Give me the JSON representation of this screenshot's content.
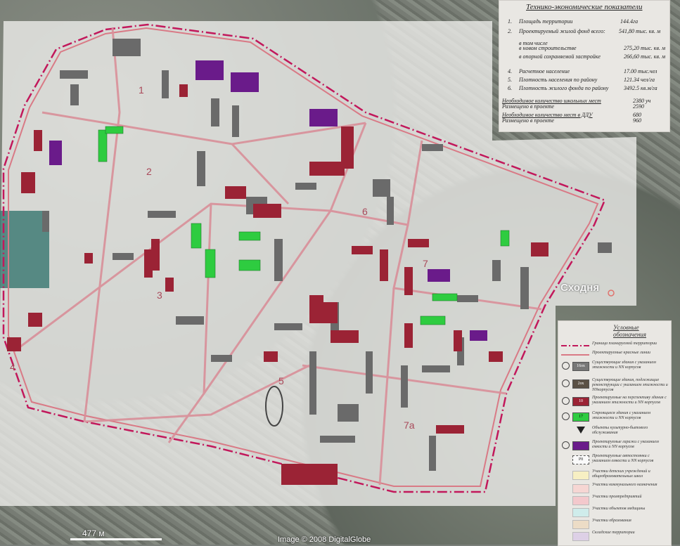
{
  "tech_panel": {
    "title": "Технико-экономические показатели",
    "rows": [
      {
        "num": "1.",
        "label": "Площадь территории",
        "value": "144.4га"
      },
      {
        "num": "2.",
        "label": "Проектируемый жилой фонд всего:",
        "value": "541,80 тыс. кв. м"
      },
      {
        "num": "",
        "label": "в том числе",
        "value": ""
      },
      {
        "num": "",
        "label": "в  новом строительстве",
        "value": "275,20  тыс. кв. м"
      },
      {
        "num": "",
        "label": "в  опорной сохраняемой застройке",
        "value": "266,60  тыс. кв. м"
      },
      {
        "num": "4.",
        "label": "Расчетное население",
        "value": "17.00 тыс.чел"
      },
      {
        "num": "5.",
        "label": "Плотность населения по району",
        "value": "121.34 чел/га"
      },
      {
        "num": "6.",
        "label": "Плотность жилого фонда по району",
        "value": "3492.5 кв.м/га"
      }
    ],
    "school_needed_label": "Необходимое количество школьных мест",
    "school_needed_value": "2380 уч",
    "school_placed_label": "Размещено в проекте",
    "school_placed_value": "2590",
    "ddu_needed_label": "Необходимое количество мест в ДДУ",
    "ddu_needed_value": "680",
    "ddu_placed_label": "Размещено в проекте",
    "ddu_placed_value": "960"
  },
  "legend": {
    "title": "Условные обозначения",
    "items": [
      {
        "symbol": "",
        "text": "Граница планируемой территории"
      },
      {
        "symbol": "",
        "text": "Проектируемые красные линии"
      },
      {
        "symbol": "16ох",
        "text": "Существующие здания с указанием этажности и NN корпусов"
      },
      {
        "symbol": "2ох",
        "text": "Существующие здания, подлежащие реконструкции с указанием этажности и NNкорпусов"
      },
      {
        "symbol": "10",
        "text": "Проектируемые на перспективу здания с указанием этажности и NN корпусов"
      },
      {
        "symbol": "17",
        "text": "Строящиеся здания с указанием этажности и NN корпусов"
      },
      {
        "symbol": "",
        "text": "Объекты культурно-бытового обслуживания"
      },
      {
        "symbol": "",
        "text": "Проектируемые гаражи с указанием емкости и NN корпусов"
      },
      {
        "symbol": "Р8",
        "text": "Проектируемые автостоянки с указанием емкости и NN корпусов"
      },
      {
        "symbol": "",
        "text": "Участки детских учреждений и общеобразовательных школ"
      },
      {
        "symbol": "",
        "text": "Участки коммунального назначения"
      },
      {
        "symbol": "",
        "text": "Участки промпредприятий"
      },
      {
        "symbol": "",
        "text": "Участки объектов медицины"
      },
      {
        "symbol": "",
        "text": "Участки образования"
      },
      {
        "symbol": "",
        "text": "Складские территории"
      }
    ]
  },
  "map": {
    "place_label": "Сходня",
    "scale_label": "477 м",
    "credit": "Image © 2008 DigitalGlobe",
    "quarters": [
      "1",
      "2",
      "3",
      "4",
      "5",
      "6",
      "7",
      "7а"
    ]
  },
  "colors": {
    "boundary": "#c2185b",
    "existing": "#6a6a6a",
    "projected": "#9b2335",
    "building": "#2ecc40",
    "garage": "#6a1b8a",
    "red_line": "#d97a86",
    "overlay": "#efefed"
  }
}
